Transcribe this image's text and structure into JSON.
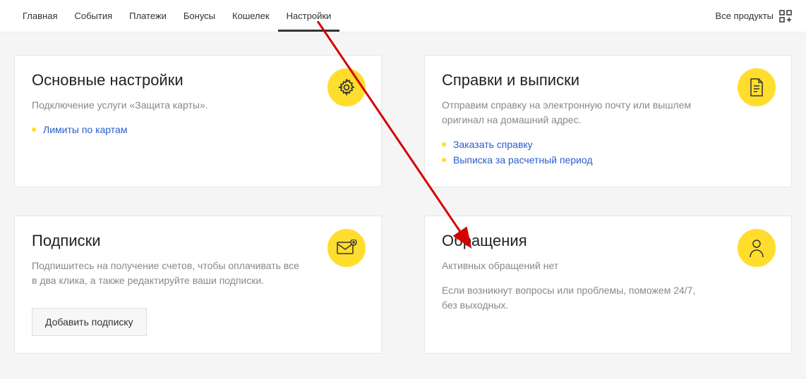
{
  "nav": {
    "tabs": [
      {
        "label": "Главная"
      },
      {
        "label": "События"
      },
      {
        "label": "Платежи"
      },
      {
        "label": "Бонусы"
      },
      {
        "label": "Кошелек"
      },
      {
        "label": "Настройки"
      }
    ],
    "active_index": 5,
    "all_products": "Все продукты"
  },
  "cards": {
    "settings": {
      "title": "Основные настройки",
      "desc": "Подключение услуги «Защита карты».",
      "links": [
        {
          "label": "Лимиты по картам"
        }
      ],
      "icon": "gear"
    },
    "statements": {
      "title": "Справки и выписки",
      "desc": "Отправим справку на электронную почту или вышлем оригинал на домашний адрес.",
      "links": [
        {
          "label": "Заказать справку"
        },
        {
          "label": "Выписка за расчетный период"
        }
      ],
      "icon": "document"
    },
    "subscriptions": {
      "title": "Подписки",
      "desc": "Подпишитесь на получение счетов, чтобы оплачивать все в два клика, а также редактируйте ваши подписки.",
      "button": "Добавить подписку",
      "icon": "envelope"
    },
    "requests": {
      "title": "Обращения",
      "desc": "Активных обращений нет",
      "sub": "Если возникнут вопросы или проблемы, поможем 24/7, без выходных.",
      "icon": "person"
    }
  },
  "colors": {
    "accent": "#ffdd2d",
    "link": "#2a5ccc",
    "arrow": "#d40000"
  }
}
